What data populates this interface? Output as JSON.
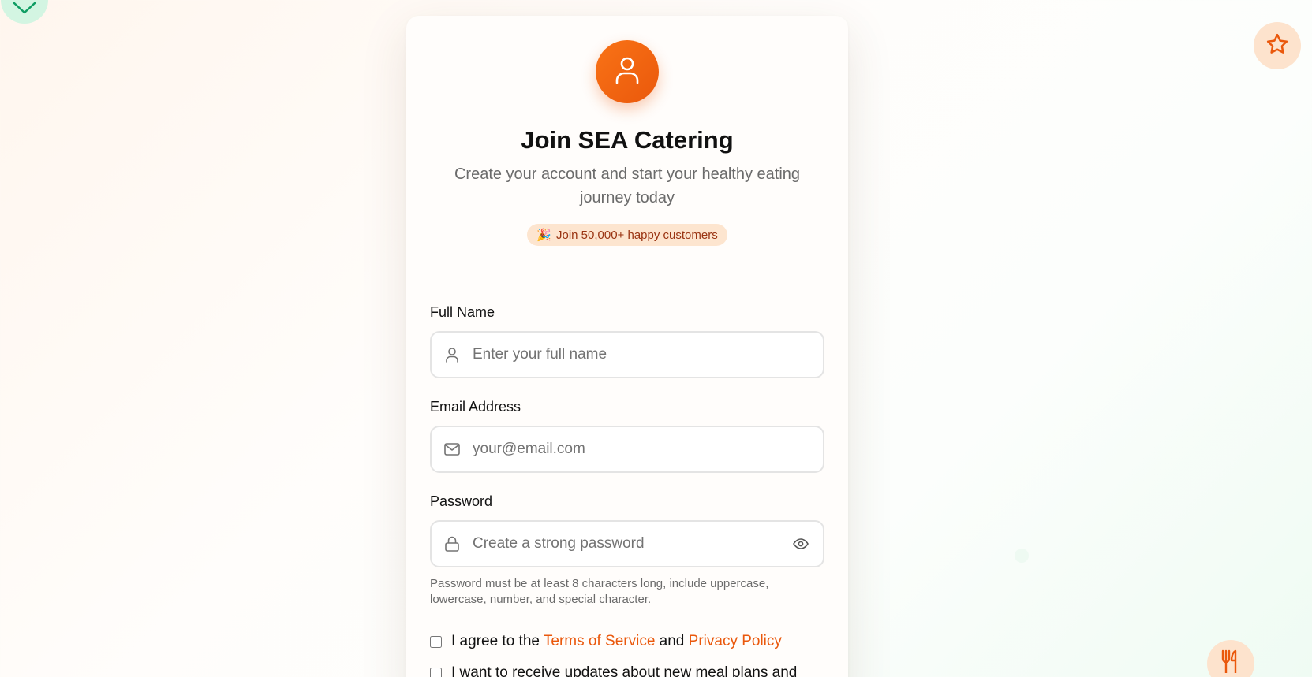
{
  "header": {
    "title": "Join SEA Catering",
    "subtitle": "Create your account and start your healthy eating journey today",
    "badge_emoji": "🎉",
    "badge_text": "Join 50,000+ happy customers"
  },
  "form": {
    "full_name": {
      "label": "Full Name",
      "placeholder": "Enter your full name",
      "value": ""
    },
    "email": {
      "label": "Email Address",
      "placeholder": "your@email.com",
      "value": ""
    },
    "password": {
      "label": "Password",
      "placeholder": "Create a strong password",
      "value": "",
      "hint": "Password must be at least 8 characters long, include uppercase, lowercase, number, and special character."
    },
    "terms": {
      "prefix": "I agree to the",
      "terms_link": "Terms of Service",
      "and": "and",
      "privacy_link": "Privacy Policy",
      "checked": false
    },
    "updates": {
      "text": "I want to receive updates about new meal plans and",
      "checked": false
    }
  },
  "icons": {
    "avatar": "user-icon",
    "name_field": "user-icon",
    "email_field": "mail-icon",
    "password_field": "lock-icon",
    "password_toggle": "eye-icon",
    "decor": [
      "heart-icon",
      "star-icon",
      "utensils-icon"
    ]
  },
  "colors": {
    "accent": "#ea580c",
    "accent_light": "#f97316",
    "badge_bg": "#fde5cf",
    "badge_text": "#9a3412",
    "green_decor": "#d3f5e2"
  }
}
